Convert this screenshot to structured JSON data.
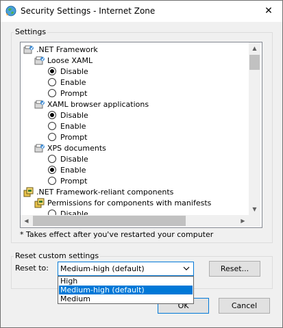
{
  "window": {
    "title": "Security Settings - Internet Zone",
    "close_glyph": "✕"
  },
  "settings_group": {
    "label": "Settings"
  },
  "tree": [
    {
      "kind": "category",
      "text": ".NET Framework",
      "icon": "settings-folder-icon"
    },
    {
      "kind": "subcategory",
      "text": "Loose XAML",
      "icon": "settings-folder-icon"
    },
    {
      "kind": "radio",
      "text": "Disable",
      "checked": true
    },
    {
      "kind": "radio",
      "text": "Enable",
      "checked": false
    },
    {
      "kind": "radio",
      "text": "Prompt",
      "checked": false
    },
    {
      "kind": "subcategory",
      "text": "XAML browser applications",
      "icon": "settings-folder-icon"
    },
    {
      "kind": "radio",
      "text": "Disable",
      "checked": true
    },
    {
      "kind": "radio",
      "text": "Enable",
      "checked": false
    },
    {
      "kind": "radio",
      "text": "Prompt",
      "checked": false
    },
    {
      "kind": "subcategory",
      "text": "XPS documents",
      "icon": "settings-folder-icon"
    },
    {
      "kind": "radio",
      "text": "Disable",
      "checked": false
    },
    {
      "kind": "radio",
      "text": "Enable",
      "checked": true
    },
    {
      "kind": "radio",
      "text": "Prompt",
      "checked": false
    },
    {
      "kind": "category",
      "text": ".NET Framework-reliant components",
      "icon": "components-icon"
    },
    {
      "kind": "subcategory",
      "text": "Permissions for components with manifests",
      "icon": "components-icon"
    },
    {
      "kind": "radio",
      "text": "Disable",
      "checked": false
    }
  ],
  "note": "* Takes effect after you've restarted your computer",
  "reset_group": {
    "label": "Reset custom settings",
    "reset_to_label": "Reset to:",
    "selected": "Medium-high (default)",
    "options": [
      "High",
      "Medium-high (default)",
      "Medium"
    ],
    "highlighted_index": 1,
    "reset_button": "Reset..."
  },
  "footer": {
    "ok": "OK",
    "cancel": "Cancel"
  },
  "colors": {
    "accent": "#0078d7",
    "window_bg": "#f0f0f0",
    "list_bg": "#ffffff"
  }
}
